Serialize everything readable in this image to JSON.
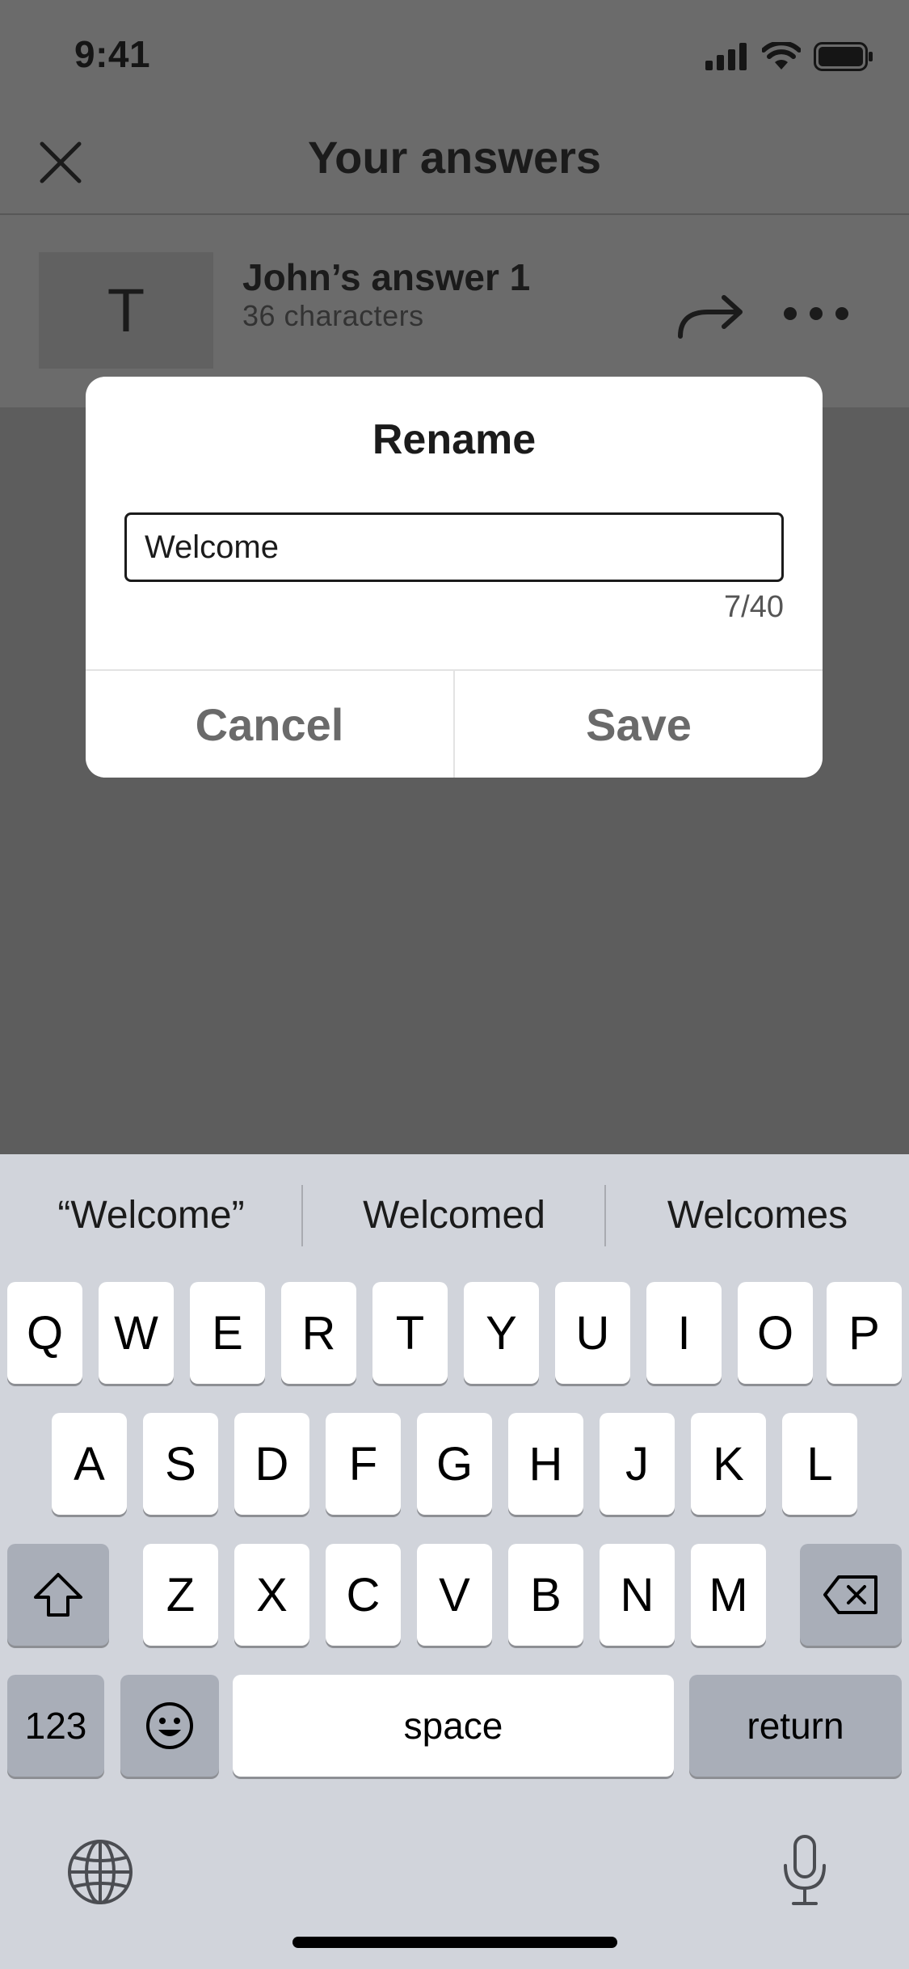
{
  "status_bar": {
    "time": "9:41"
  },
  "navbar": {
    "title": "Your answers"
  },
  "list": {
    "items": [
      {
        "thumb_letter": "T",
        "title": "John’s answer 1",
        "subtitle": "36 characters"
      }
    ]
  },
  "dialog": {
    "title": "Rename",
    "input_value": "Welcome",
    "char_count": "7/40",
    "cancel_label": "Cancel",
    "save_label": "Save"
  },
  "keyboard": {
    "suggestions": [
      "“Welcome”",
      "Welcomed",
      "Welcomes"
    ],
    "row1": [
      "Q",
      "W",
      "E",
      "R",
      "T",
      "Y",
      "U",
      "I",
      "O",
      "P"
    ],
    "row2": [
      "A",
      "S",
      "D",
      "F",
      "G",
      "H",
      "J",
      "K",
      "L"
    ],
    "row3": [
      "Z",
      "X",
      "C",
      "V",
      "B",
      "N",
      "M"
    ],
    "numbers_label": "123",
    "space_label": "space",
    "return_label": "return"
  }
}
